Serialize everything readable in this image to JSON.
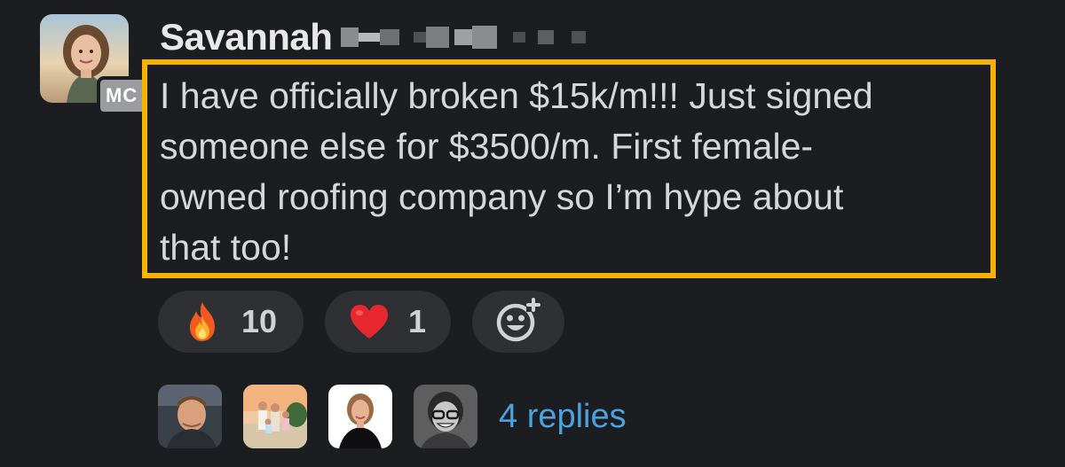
{
  "message": {
    "sender_name": "Savannah",
    "org_badge": "MC",
    "text": "I have officially broken $15k/m!!! Just signed\nsomeone else for $3500/m. First female-\nowned roofing company so I’m hype about\nthat too!",
    "highlight_color": "#f5b301"
  },
  "reactions": [
    {
      "icon": "fire-emoji",
      "count": "10"
    },
    {
      "icon": "red-heart-emoji",
      "count": "1"
    },
    {
      "icon": "add-reaction-icon"
    }
  ],
  "thread": {
    "replies_label": "4 replies",
    "link_color": "#4aa3df"
  }
}
